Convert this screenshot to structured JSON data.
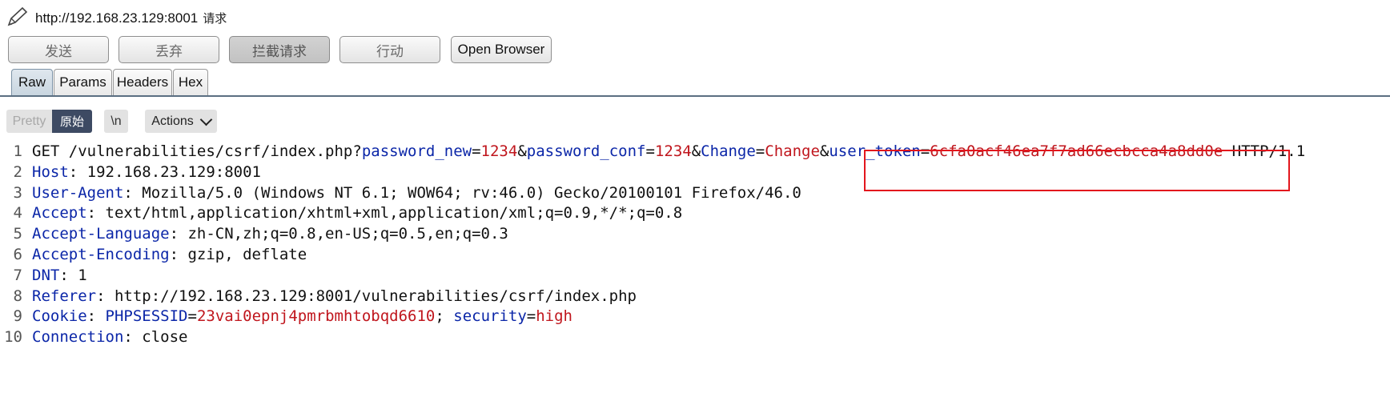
{
  "window": {
    "url": "http://192.168.23.129:8001",
    "suffix": "请求"
  },
  "toolbar": {
    "send": "发送",
    "drop": "丢弃",
    "intercept": "拦截请求",
    "action": "行动",
    "open_browser": "Open Browser"
  },
  "tabs": [
    "Raw",
    "Params",
    "Headers",
    "Hex"
  ],
  "editor": {
    "pretty": "Pretty",
    "raw": "原始",
    "newline": "\\n",
    "actions": "Actions"
  },
  "request_lines": [
    {
      "n": "1",
      "parts": [
        {
          "t": "GET /vulnerabilities/csrf/index.php?",
          "c": "plain"
        },
        {
          "t": "password_new",
          "c": "k"
        },
        {
          "t": "=",
          "c": "plain"
        },
        {
          "t": "1234",
          "c": "v"
        },
        {
          "t": "&",
          "c": "plain"
        },
        {
          "t": "password_conf",
          "c": "k"
        },
        {
          "t": "=",
          "c": "plain"
        },
        {
          "t": "1234",
          "c": "v"
        },
        {
          "t": "&",
          "c": "plain"
        },
        {
          "t": "Change",
          "c": "k"
        },
        {
          "t": "=",
          "c": "plain"
        },
        {
          "t": "Change",
          "c": "v"
        },
        {
          "t": "&",
          "c": "plain"
        },
        {
          "t": "user_token",
          "c": "k"
        },
        {
          "t": "=",
          "c": "plain"
        },
        {
          "t": "6cfa0acf46ea7f7ad66ecbcca4a8dd0e",
          "c": "v"
        },
        {
          "t": " HTTP/1.1",
          "c": "plain"
        }
      ]
    },
    {
      "n": "2",
      "parts": [
        {
          "t": "Host",
          "c": "k"
        },
        {
          "t": ": 192.168.23.129:8001",
          "c": "plain"
        }
      ]
    },
    {
      "n": "3",
      "parts": [
        {
          "t": "User-Agent",
          "c": "k"
        },
        {
          "t": ": Mozilla/5.0 (Windows NT 6.1; WOW64; rv:46.0) Gecko/20100101 Firefox/46.0",
          "c": "plain"
        }
      ]
    },
    {
      "n": "4",
      "parts": [
        {
          "t": "Accept",
          "c": "k"
        },
        {
          "t": ": text/html,application/xhtml+xml,application/xml;q=0.9,*/*;q=0.8",
          "c": "plain"
        }
      ]
    },
    {
      "n": "5",
      "parts": [
        {
          "t": "Accept-Language",
          "c": "k"
        },
        {
          "t": ": zh-CN,zh;q=0.8,en-US;q=0.5,en;q=0.3",
          "c": "plain"
        }
      ]
    },
    {
      "n": "6",
      "parts": [
        {
          "t": "Accept-Encoding",
          "c": "k"
        },
        {
          "t": ": gzip, deflate",
          "c": "plain"
        }
      ]
    },
    {
      "n": "7",
      "parts": [
        {
          "t": "DNT",
          "c": "k"
        },
        {
          "t": ": 1",
          "c": "plain"
        }
      ]
    },
    {
      "n": "8",
      "parts": [
        {
          "t": "Referer",
          "c": "k"
        },
        {
          "t": ": http://192.168.23.129:8001/vulnerabilities/csrf/index.php",
          "c": "plain"
        }
      ]
    },
    {
      "n": "9",
      "parts": [
        {
          "t": "Cookie",
          "c": "k"
        },
        {
          "t": ": ",
          "c": "plain"
        },
        {
          "t": "PHPSESSID",
          "c": "k"
        },
        {
          "t": "=",
          "c": "plain"
        },
        {
          "t": "23vai0epnj4pmrbmhtobqd6610",
          "c": "v"
        },
        {
          "t": "; ",
          "c": "plain"
        },
        {
          "t": "security",
          "c": "k"
        },
        {
          "t": "=",
          "c": "plain"
        },
        {
          "t": "high",
          "c": "v"
        }
      ]
    },
    {
      "n": "10",
      "parts": [
        {
          "t": "Connection",
          "c": "k"
        },
        {
          "t": ": close",
          "c": "plain"
        }
      ]
    }
  ],
  "colors": {
    "key": "#0b26a8",
    "value": "#c0161d",
    "highlight_border": "#e3161d",
    "selected_segment": "#3d4a63"
  }
}
